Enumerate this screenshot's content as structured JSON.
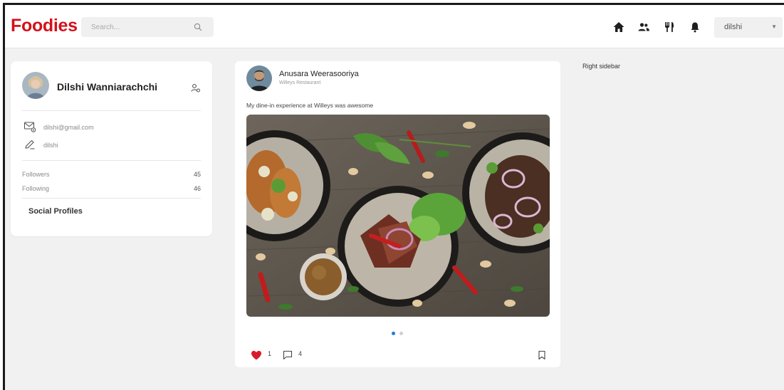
{
  "header": {
    "logo": "Foodies",
    "search_placeholder": "Search...",
    "icons": [
      "home-icon",
      "friends-icon",
      "restaurant-icon",
      "bell-icon"
    ],
    "user_select_value": "dilshi"
  },
  "profile": {
    "name": "Dilshi Wanniarachchi",
    "email": "dilshi@gmail.com",
    "username": "dilshi",
    "followers_label": "Followers",
    "followers_count": "45",
    "following_label": "Following",
    "following_count": "46",
    "social_label": "Social Profiles"
  },
  "post": {
    "author": "Anusara Weerasooriya",
    "place": "Willeys Restaurant",
    "caption": "My dine-in experience at Willeys was awesome",
    "likes": "1",
    "comments": "4",
    "carousel_count": 2,
    "carousel_active": 0
  },
  "right_sidebar": {
    "label": "Right sidebar"
  },
  "colors": {
    "brand": "#d2121a",
    "like": "#d81b2c",
    "carousel_active": "#1e7be0",
    "background": "#f1f1f1"
  }
}
